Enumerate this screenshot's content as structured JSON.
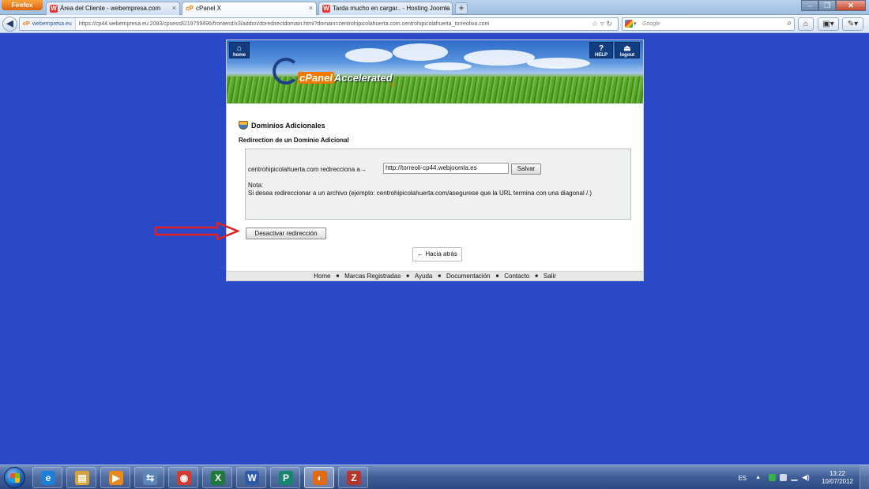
{
  "browser": {
    "menu_button": "Firefox",
    "tabs": [
      {
        "label": "Área del Cliente - webempresa.com",
        "icon": "webempresa-icon"
      },
      {
        "label": "cPanel X",
        "icon": "cpanel-icon",
        "active": true
      },
      {
        "label": "Tarda mucho en cargar.. - Hosting Joomla",
        "icon": "webempresa-icon"
      }
    ],
    "site_identity": "webempresa.eu",
    "site_identity_icon": "cP",
    "url": "https://cp44.webempresa.eu:2083/cpsess8219759496/frontend/x3/addon/doredirectdomain.html?domain=centrohipicolahuerta.com.centrohipicolahuerta_torreoliva.com",
    "search_placeholder": "Google"
  },
  "cpanel": {
    "header": {
      "home_label": "home",
      "help_label": "HELP",
      "logout_label": "logout",
      "logo_cp": "cP",
      "logo_cpanel": "cPanel",
      "logo_accelerated": "Accelerated",
      "logo_sub": "2"
    },
    "section_title": "Dominios Adicionales",
    "subtitle": "Redirection de un Dominio Adicional",
    "redirect_label": "centrohipicolahuerta.com redirecciona a→",
    "redirect_value": "http://torreoli-cp44.webjoomla.es",
    "save_button": "Salvar",
    "note_label": "Nota:",
    "note_text": "Si desea redireccionar a un archivo (ejemplo: centrohipicolahuerta.com/asegurese que la URL termina con una diagonal /.)",
    "deactivate_button": "Desactivar redirección",
    "back_button": "← Hacia atrás",
    "footer_links": [
      "Home",
      "Marcas Registradas",
      "Ayuda",
      "Documentación",
      "Contacto",
      "Salir"
    ],
    "footer_separator": "■"
  },
  "taskbar": {
    "apps": [
      {
        "name": "internet-explorer-icon",
        "glyph": "e",
        "color": "#1d7fd8"
      },
      {
        "name": "file-explorer-icon",
        "glyph": "▤",
        "color": "#d9a33a"
      },
      {
        "name": "media-player-icon",
        "glyph": "▶",
        "color": "#e88a1a"
      },
      {
        "name": "network-icon",
        "glyph": "⇆",
        "color": "#5c86b8"
      },
      {
        "name": "chrome-icon",
        "glyph": "◉",
        "color": "#d43b2f"
      },
      {
        "name": "excel-icon",
        "glyph": "X",
        "color": "#1e7a3c"
      },
      {
        "name": "word-icon",
        "glyph": "W",
        "color": "#2b5aa8"
      },
      {
        "name": "publisher-icon",
        "glyph": "P",
        "color": "#17866f"
      },
      {
        "name": "firefox-icon",
        "glyph": "◐",
        "color": "#e26a12",
        "active": true
      },
      {
        "name": "filezilla-icon",
        "glyph": "Z",
        "color": "#b8342a"
      }
    ],
    "language": "ES",
    "time": "13:22",
    "date": "10/07/2012"
  },
  "colors": {
    "desktop": "#2a49c8",
    "arrow": "#e02020",
    "cpanel_orange": "#f07800",
    "cpanel_navy": "#1f3f86"
  }
}
